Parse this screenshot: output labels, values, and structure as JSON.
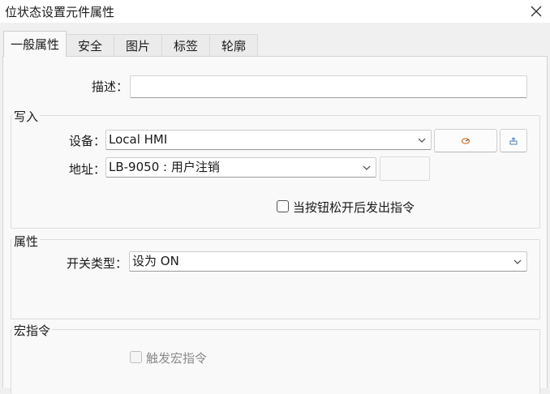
{
  "window": {
    "title": "位状态设置元件属性"
  },
  "tabs": [
    {
      "label": "一般属性"
    },
    {
      "label": "安全"
    },
    {
      "label": "图片"
    },
    {
      "label": "标签"
    },
    {
      "label": "轮廓"
    }
  ],
  "active_tab": 0,
  "general": {
    "description_label": "描述：",
    "description_value": ""
  },
  "write": {
    "title": "写入",
    "device_label": "设备：",
    "device_value": "Local HMI",
    "address_label": "地址：",
    "address_value": "LB-9050 : 用户注销",
    "address_index_value": "",
    "release_checkbox_label": "当按钮松开后发出指令",
    "release_checkbox_checked": false
  },
  "attributes": {
    "title": "属性",
    "switch_type_label": "开关类型：",
    "switch_type_value": "设为 ON"
  },
  "macro": {
    "title": "宏指令",
    "trigger_label": "触发宏指令",
    "trigger_checked": false,
    "trigger_enabled": false
  },
  "icons": {
    "close": "close-icon",
    "device_settings": "settings-icon",
    "device_import": "import-icon",
    "dropdown": "chevron-down-icon"
  },
  "colors": {
    "panel_background": "#f9f9f9",
    "window_background": "#f0f0f0",
    "disabled_text": "#8a8a8a"
  }
}
